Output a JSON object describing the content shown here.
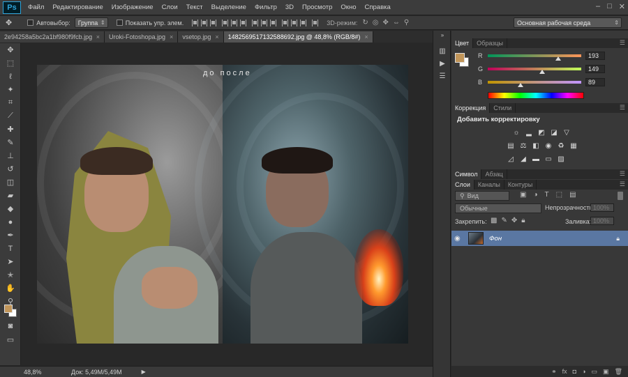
{
  "app": {
    "logo": "Ps"
  },
  "menu": [
    "Файл",
    "Редактирование",
    "Изображение",
    "Слои",
    "Текст",
    "Выделение",
    "Фильтр",
    "3D",
    "Просмотр",
    "Окно",
    "Справка"
  ],
  "window_controls": {
    "min": "–",
    "max": "□",
    "close": "✕"
  },
  "options": {
    "autoselect_label": "Автовыбор:",
    "autoselect_value": "Группа",
    "show_controls_label": "Показать упр. элем.",
    "mode3d_label": "3D-режим:",
    "workspace_value": "Основная рабочая среда"
  },
  "tabs": [
    {
      "label": "2e94258a5bc2a1bf980f9fcb.jpg",
      "close": "×"
    },
    {
      "label": "Uroki-Fotoshopa.jpg",
      "close": "×"
    },
    {
      "label": "vsetop.jpg",
      "close": "×"
    },
    {
      "label": "1482569517132588692.jpg @ 48,8% (RGB/8#)",
      "close": "×"
    }
  ],
  "canvas": {
    "before_after_text": "до  после"
  },
  "status": {
    "zoom": "48,8%",
    "doc_info": "Док: 5,49M/5,49M",
    "arrow": "▶"
  },
  "color_panel": {
    "tabs": [
      "Цвет",
      "Образцы"
    ],
    "fg_color": "#c19559",
    "sliders": [
      {
        "label": "R",
        "value": "193",
        "level": 0.757
      },
      {
        "label": "G",
        "value": "149",
        "level": 0.584
      },
      {
        "label": "B",
        "value": "89",
        "level": 0.349
      }
    ]
  },
  "adjustments_panel": {
    "tabs": [
      "Коррекция",
      "Стили"
    ],
    "title": "Добавить корректировку"
  },
  "char_panel": {
    "tabs": [
      "Символ",
      "Абзац"
    ]
  },
  "layers_panel": {
    "tabs": [
      "Слои",
      "Каналы",
      "Контуры"
    ],
    "filter_value": "Вид",
    "blend_mode": "Обычные",
    "opacity_label": "Непрозрачность:",
    "opacity_value": "100%",
    "lock_label": "Закрепить:",
    "fill_label": "Заливка:",
    "fill_value": "100%",
    "layers": [
      {
        "name": "Фон",
        "visible": true,
        "locked": true
      }
    ]
  }
}
